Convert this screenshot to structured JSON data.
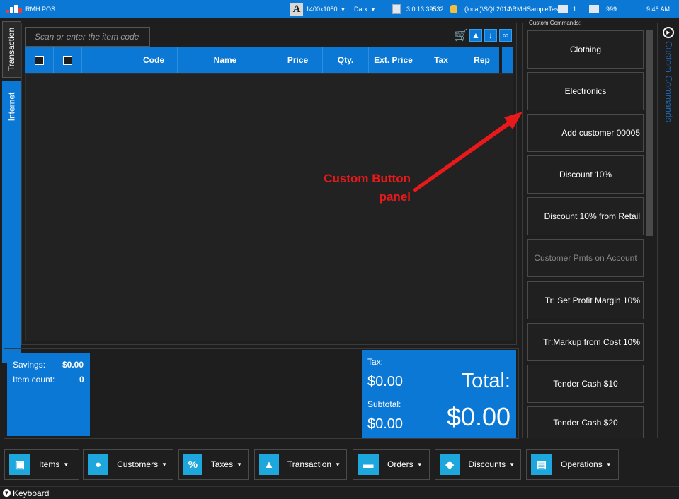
{
  "titlebar": {
    "app_name": "RMH POS",
    "resolution": "1400x1050",
    "theme": "Dark",
    "version": "3.0.13.39532",
    "database": "(local)\\SQL2014\\RMHSampleTest",
    "register": "1",
    "user": "999",
    "time": "9:46 AM"
  },
  "left_tabs": [
    "Transaction",
    "Internet"
  ],
  "scan": {
    "placeholder": "Scan or enter the item code"
  },
  "grid": {
    "columns": [
      "Code",
      "Name",
      "Price",
      "Qty.",
      "Ext. Price",
      "Tax",
      "Rep"
    ]
  },
  "annotation": {
    "line1": "Custom Button",
    "line2": "panel"
  },
  "custom_commands": {
    "label": "Custom Commands:",
    "side_title": "Custom Commands",
    "buttons": [
      {
        "label": "Clothing",
        "enabled": true
      },
      {
        "label": "Electronics",
        "enabled": true
      },
      {
        "label": "Add customer 00005",
        "enabled": true
      },
      {
        "label": "Discount 10%",
        "enabled": true
      },
      {
        "label": "Discount 10% from Retail",
        "enabled": true
      },
      {
        "label": "Customer Pmts on Account",
        "enabled": false
      },
      {
        "label": "Tr: Set Profit Margin 10%",
        "enabled": true
      },
      {
        "label": "Tr:Markup from Cost 10%",
        "enabled": true
      },
      {
        "label": "Tender Cash $10",
        "enabled": true
      },
      {
        "label": "Tender Cash $20",
        "enabled": true
      }
    ]
  },
  "summary": {
    "savings_label": "Savings:",
    "savings_value": "$0.00",
    "item_count_label": "Item count:",
    "item_count_value": "0",
    "tax_label": "Tax:",
    "tax_value": "$0.00",
    "subtotal_label": "Subtotal:",
    "subtotal_value": "$0.00",
    "total_label": "Total:",
    "total_value": "$0.00"
  },
  "toolbar": [
    {
      "label": "Items",
      "icon": "box-icon"
    },
    {
      "label": "Customers",
      "icon": "person-icon"
    },
    {
      "label": "Taxes",
      "icon": "percent-icon"
    },
    {
      "label": "Transaction",
      "icon": "bag-icon"
    },
    {
      "label": "Orders",
      "icon": "basket-icon"
    },
    {
      "label": "Discounts",
      "icon": "tag-icon"
    },
    {
      "label": "Operations",
      "icon": "register-icon"
    }
  ],
  "keyboard_label": "Keyboard",
  "colors": {
    "accent": "#0a78d4",
    "annotation": "#e8191b",
    "background": "#1e1e1e"
  }
}
